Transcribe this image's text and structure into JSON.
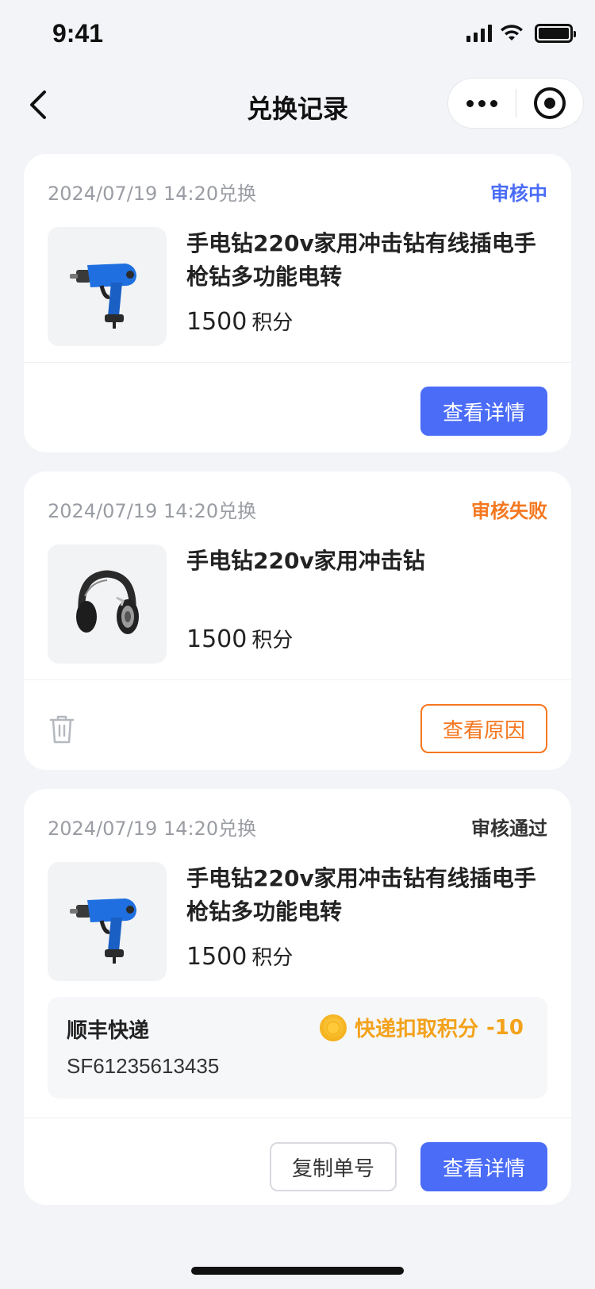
{
  "status_bar": {
    "time": "9:41"
  },
  "nav": {
    "title": "兑换记录"
  },
  "records": [
    {
      "date": "2024/07/19 14:20兑换",
      "status": "审核中",
      "status_color": "#4A6CF7",
      "product_name": "手电钻220v家用冲击钻有线插电手枪钻多功能电转",
      "points": "1500",
      "points_unit": "积分",
      "image": "power-drill",
      "primary_button": "查看详情"
    },
    {
      "date": "2024/07/19 14:20兑换",
      "status": "审核失败",
      "status_color": "#F5771F",
      "product_name": "手电钻220v家用冲击钻",
      "points": "1500",
      "points_unit": "积分",
      "image": "headphones",
      "delete_icon": "trash-icon",
      "primary_button": "查看原因"
    },
    {
      "date": "2024/07/19 14:20兑换",
      "status": "审核通过",
      "status_color": "#333333",
      "product_name": "手电钻220v家用冲击钻有线插电手枪钻多功能电转",
      "points": "1500",
      "points_unit": "积分",
      "image": "power-drill",
      "express": {
        "company": "顺丰快递",
        "tracking_no": "SF61235613435",
        "fee_label": "快递扣取积分",
        "fee_value": "-10"
      },
      "secondary_button": "复制单号",
      "primary_button": "查看详情"
    }
  ]
}
